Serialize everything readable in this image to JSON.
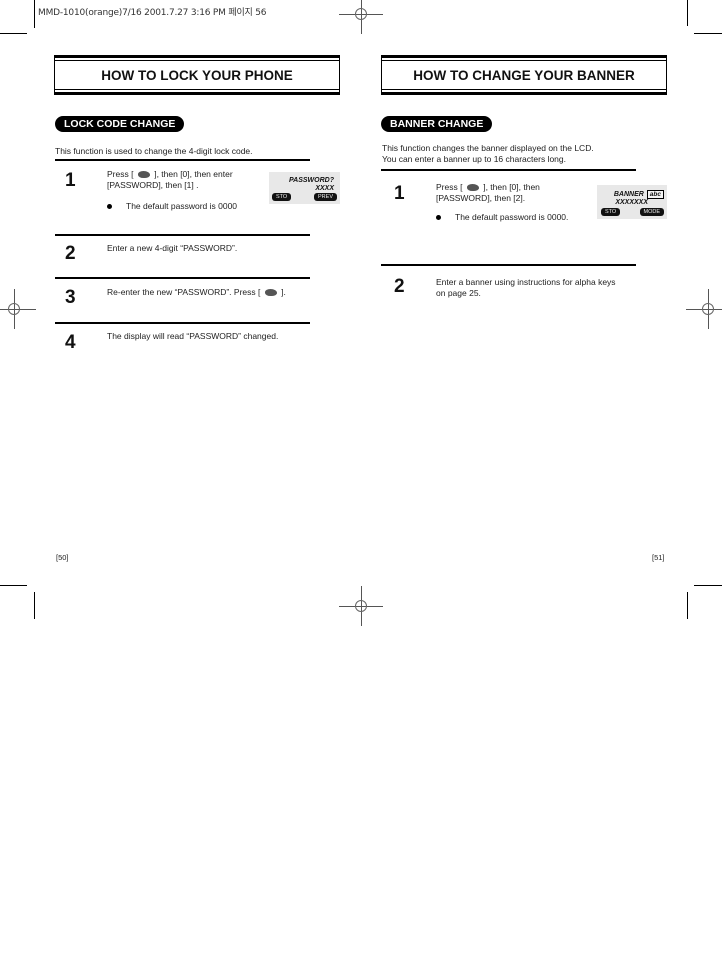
{
  "print_header": "MMD-1010(orange)7/16  2001.7.27 3:16 PM 페이지 56",
  "left_page": {
    "title": "HOW TO LOCK YOUR PHONE",
    "section_label": "LOCK CODE CHANGE",
    "intro": "This function is used to change the 4-digit lock code.",
    "steps": [
      {
        "number": "1",
        "text_before_icon": "Press [",
        "text_after_icon": "], then [0], then enter",
        "text_line2": "[PASSWORD], then [1] .",
        "bullet": "The default password is 0000",
        "lcd": {
          "line1": "PASSWORD?",
          "line2": "XXXX",
          "soft_left": "STO",
          "soft_right": "PREV"
        }
      },
      {
        "number": "2",
        "text": "Enter a new 4-digit “PASSWORD”."
      },
      {
        "number": "3",
        "text_before_icon": "Re-enter the new “PASSWORD”.  Press [",
        "text_after_icon": "]."
      },
      {
        "number": "4",
        "text": "The display will read “PASSWORD” changed."
      }
    ],
    "page_number": "[50]"
  },
  "right_page": {
    "title": "HOW TO CHANGE YOUR BANNER",
    "section_label": "BANNER CHANGE",
    "intro_line1": "This function changes the banner displayed on the LCD.",
    "intro_line2": "You can enter a banner up to 16 characters long.",
    "steps": [
      {
        "number": "1",
        "text_before_icon": "Press [",
        "text_after_icon": "], then [0], then",
        "text_line2": "[PASSWORD], then [2].",
        "bullet": "The default password is 0000.",
        "lcd": {
          "line1": "BANNER",
          "badge": "abc",
          "line2": "XXXXXXX",
          "soft_left": "STO",
          "soft_right": "MODE"
        }
      },
      {
        "number": "2",
        "text_line1": "Enter a banner using instructions for alpha keys",
        "text_line2": "on page 25."
      }
    ],
    "page_number": "[51]"
  },
  "icons": {
    "menu_key": "menu-key-icon"
  }
}
